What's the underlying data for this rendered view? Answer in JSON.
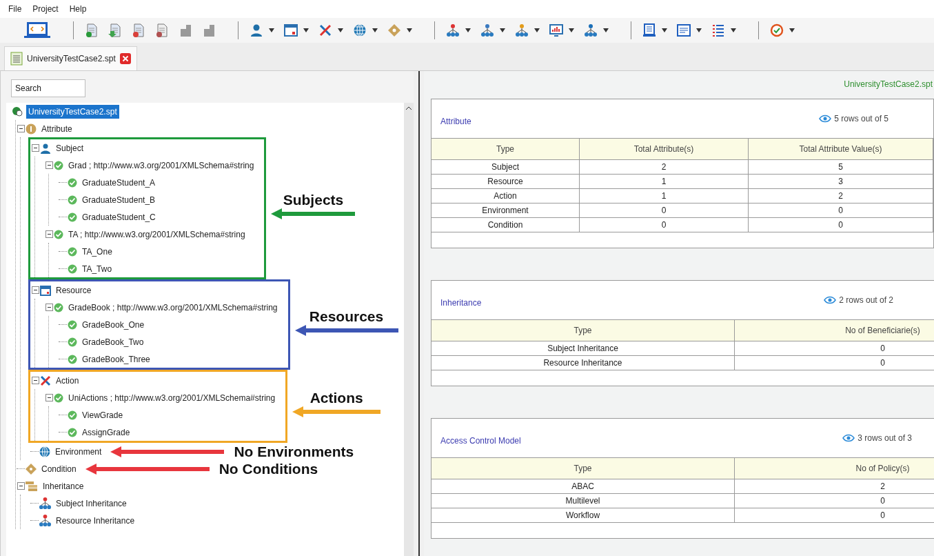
{
  "menu": [
    "File",
    "Project",
    "Help"
  ],
  "tab": {
    "label": "UniversityTestCase2.spt",
    "selected": true
  },
  "search": {
    "placeholder": "Search"
  },
  "tree": {
    "label": "UniversityTestCase2.spt",
    "kind": "project",
    "selected": true,
    "children": [
      {
        "label": "Attribute",
        "kind": "attribute",
        "selected": false,
        "expanded": true,
        "children": [
          {
            "label": "Subject",
            "kind": "subject",
            "selected": false,
            "expanded": true,
            "callout": {
              "label": "Subjects",
              "color": "#1e9a3c",
              "framed": true
            },
            "children": [
              {
                "label": "Grad ; http://www.w3.org/2001/XMLSchema#string",
                "kind": "value",
                "selected": false,
                "expanded": true,
                "children": [
                  {
                    "label": "GraduateStudent_A",
                    "kind": "value",
                    "selected": false
                  },
                  {
                    "label": "GraduateStudent_B",
                    "kind": "value",
                    "selected": false
                  },
                  {
                    "label": "GraduateStudent_C",
                    "kind": "value",
                    "selected": false
                  }
                ]
              },
              {
                "label": "TA ; http://www.w3.org/2001/XMLSchema#string",
                "kind": "value",
                "selected": false,
                "expanded": true,
                "children": [
                  {
                    "label": "TA_One",
                    "kind": "value",
                    "selected": false
                  },
                  {
                    "label": "TA_Two",
                    "kind": "value",
                    "selected": false
                  }
                ]
              }
            ]
          },
          {
            "label": "Resource",
            "kind": "resource",
            "selected": false,
            "expanded": true,
            "callout": {
              "label": "Resources",
              "color": "#3d56b4",
              "framed": true
            },
            "children": [
              {
                "label": "GradeBook ; http://www.w3.org/2001/XMLSchema#string",
                "kind": "value",
                "selected": false,
                "expanded": true,
                "children": [
                  {
                    "label": "GradeBook_One",
                    "kind": "value",
                    "selected": false
                  },
                  {
                    "label": "GradeBook_Two",
                    "kind": "value",
                    "selected": false
                  },
                  {
                    "label": "GradeBook_Three",
                    "kind": "value",
                    "selected": false
                  }
                ]
              }
            ]
          },
          {
            "label": "Action",
            "kind": "action",
            "selected": false,
            "expanded": true,
            "callout": {
              "label": "Actions",
              "color": "#f0a725",
              "framed": true
            },
            "children": [
              {
                "label": "UniActions ; http://www.w3.org/2001/XMLSchema#string",
                "kind": "value",
                "selected": false,
                "expanded": true,
                "children": [
                  {
                    "label": "ViewGrade",
                    "kind": "value",
                    "selected": false
                  },
                  {
                    "label": "AssignGrade",
                    "kind": "value",
                    "selected": false
                  }
                ]
              }
            ]
          },
          {
            "label": "Environment",
            "kind": "environment",
            "selected": false,
            "callout": {
              "label": "No Environments",
              "color": "#e8363d",
              "framed": false
            }
          }
        ]
      },
      {
        "label": "Condition",
        "kind": "condition",
        "selected": false,
        "callout": {
          "label": "No Conditions",
          "color": "#e8363d",
          "framed": false
        }
      },
      {
        "label": "Inheritance",
        "kind": "inheritance",
        "selected": false,
        "expanded": true,
        "children": [
          {
            "label": "Subject Inheritance",
            "kind": "hierarchy",
            "selected": false
          },
          {
            "label": "Resource Inheritance",
            "kind": "hierarchy",
            "selected": false
          }
        ]
      }
    ]
  },
  "summary": {
    "title": "UniversityTestCase2.spt",
    "cards": [
      {
        "title": "Attribute",
        "rows_note": "5 rows out of 5",
        "columns": [
          "Type",
          "Total Attribute(s)",
          "Total Attribute Value(s)"
        ],
        "rows": [
          [
            "Subject",
            "2",
            "5"
          ],
          [
            "Resource",
            "1",
            "3"
          ],
          [
            "Action",
            "1",
            "2"
          ],
          [
            "Environment",
            "0",
            "0"
          ],
          [
            "Condition",
            "0",
            "0"
          ]
        ]
      },
      {
        "title": "Inheritance",
        "rows_note": "2 rows out of 2",
        "columns": [
          "Type",
          "No of Beneficiarie(s)"
        ],
        "rows": [
          [
            "Subject Inheritance",
            "0"
          ],
          [
            "Resource Inheritance",
            "0"
          ]
        ]
      },
      {
        "title": "Access Control Model",
        "rows_note": "3 rows out of 3",
        "columns": [
          "Type",
          "No of Policy(s)"
        ],
        "rows": [
          [
            "ABAC",
            "2"
          ],
          [
            "Multilevel",
            "0"
          ],
          [
            "Workflow",
            "0"
          ]
        ]
      }
    ]
  }
}
